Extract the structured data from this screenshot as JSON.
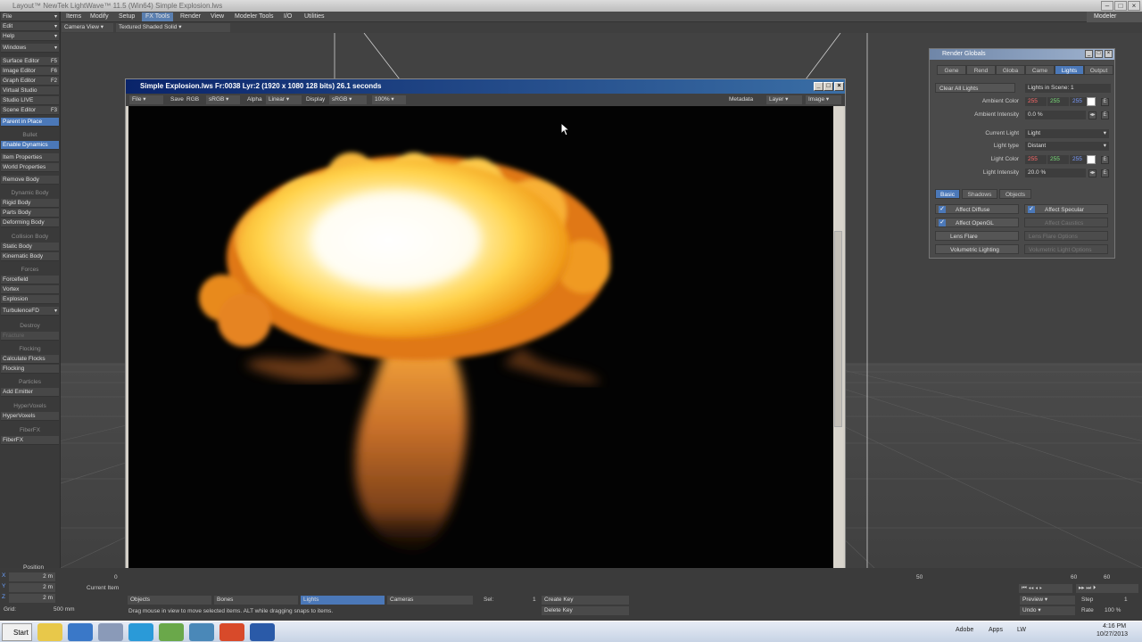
{
  "app": {
    "title": "Layout™ NewTek LightWave™ 11.5 (Win64)   Simple Explosion.lws",
    "modeler_label": "Modeler"
  },
  "menu": {
    "left": [
      "File",
      "Edit",
      "Help",
      "Windows"
    ],
    "tabs": [
      "Items",
      "Modify",
      "Setup",
      "FX Tools",
      "Render",
      "View",
      "Modeler Tools",
      "I/O",
      "Utilities"
    ],
    "active_tab": "FX Tools"
  },
  "sidebar": {
    "tools": [
      "Surface Editor",
      "Image Editor",
      "Graph Editor",
      "Virtual Studio",
      "Studio LIVE",
      "Scene Editor"
    ],
    "tool_keys": [
      "F5",
      "F6",
      "F2",
      "",
      "",
      "F3"
    ],
    "parent_in_place": "Parent in Place",
    "bullet_head": "Bullet",
    "bullet_items": [
      "Enable Dynamics",
      "Item Properties",
      "World Properties",
      "Remove Body"
    ],
    "dynamic_head": "Dynamic Body",
    "dynamic_items": [
      "Rigid Body",
      "Parts Body",
      "Deforming Body"
    ],
    "collision_head": "Collision Body",
    "collision_items": [
      "Static Body",
      "Kinematic Body"
    ],
    "forces_head": "Forces",
    "forces_items": [
      "Forcefield",
      "Vortex",
      "Explosion",
      "TurbulenceFD"
    ],
    "destroy_head": "Destroy",
    "destroy_items": [
      "Fracture"
    ],
    "flocking_head": "Flocking",
    "flocking_items": [
      "Calculate Flocks",
      "Flocking"
    ],
    "particles_head": "Particles",
    "particles_items": [
      "Add Emitter"
    ],
    "hyper_head": "HyperVoxels",
    "hyper_items": [
      "HyperVoxels"
    ],
    "fiber_head": "FiberFX",
    "fiber_items": [
      "FiberFX"
    ]
  },
  "viewport_toolbar": {
    "view": "Camera View",
    "shading": "Textured Shaded Solid"
  },
  "render_window": {
    "title": "Simple Explosion.lws Fr:0038 Lyr:2  (1920 x 1080 128 bits) 26.1 seconds",
    "file": "File",
    "save_label": "Save",
    "save_value": "RGB",
    "save_space": "sRGB",
    "alpha_label": "Alpha",
    "alpha_value": "Linear",
    "display_label": "Display",
    "display_value": "sRGB",
    "zoom": "100%",
    "metadata": "Metadata",
    "layer": "Layer",
    "image": "Image",
    "scroll_grip": "|||"
  },
  "globals": {
    "title": "Render Globals",
    "tabs": [
      "Gene",
      "Rend",
      "Globa",
      "Came",
      "Lights",
      "Output"
    ],
    "active_tab": "Lights",
    "clear_all": "Clear All Lights",
    "lights_in_scene": "Lights in Scene: 1",
    "ambient_color_label": "Ambient Color",
    "ambient_rgb": [
      "255",
      "255",
      "255"
    ],
    "ambient_intensity_label": "Ambient Intensity",
    "ambient_intensity": "0.0 %",
    "current_light_label": "Current Light",
    "current_light": "Light",
    "light_type_label": "Light type",
    "light_type": "Distant",
    "light_color_label": "Light Color",
    "light_rgb": [
      "255",
      "255",
      "255"
    ],
    "light_intensity_label": "Light Intensity",
    "light_intensity": "20.0 %",
    "subtabs": [
      "Basic",
      "Shadows",
      "Objects"
    ],
    "active_subtab": "Basic",
    "affect_diffuse": "Affect Diffuse",
    "affect_specular": "Affect Specular",
    "affect_opengl": "Affect OpenGL",
    "affect_caustics": "Affect Caustics",
    "lens_flare": "Lens Flare",
    "lens_flare_options": "Lens Flare Options",
    "volumetric": "Volumetric Lighting",
    "volumetric_options": "Volumetric Light Options"
  },
  "bottom": {
    "position_label": "Position",
    "x_val": "2 m",
    "y_val": "2 m",
    "z_val": "2 m",
    "frame_start": "0",
    "current_item": "Current Item",
    "grid_label": "Grid:",
    "grid_val": "500 mm",
    "timeline_50": "50",
    "timeline_60a": "60",
    "timeline_60b": "60",
    "objects": "Objects",
    "bones": "Bones",
    "lights": "Lights",
    "cameras": "Cameras",
    "sel_label": "Sel:",
    "sel_val": "1",
    "create_key": "Create Key",
    "delete_key": "Delete Key",
    "status": "Drag mouse in view to move selected items. ALT while dragging snaps to items.",
    "preview": "Preview",
    "undo": "Undo",
    "step": "Step",
    "step_val": "1",
    "rate": "Rate",
    "rate_val": "100 %"
  },
  "taskbar": {
    "start": "Start",
    "tray_items": [
      "Adobe",
      "Apps",
      "LW"
    ],
    "time": "4:16 PM",
    "date": "10/27/2013"
  }
}
